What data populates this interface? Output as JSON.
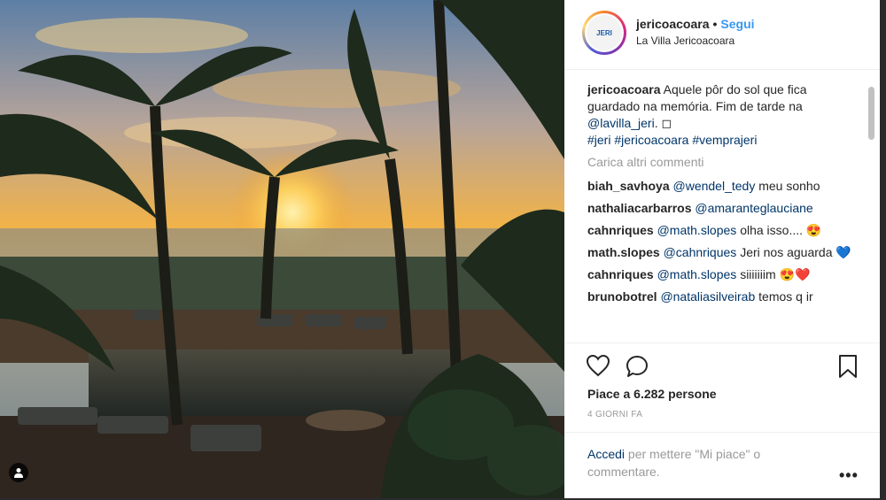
{
  "post": {
    "username": "jericoacoara",
    "follow_label": "Segui",
    "separator": "•",
    "location": "La Villa Jericoacoara",
    "avatar_text": "JERI"
  },
  "caption": {
    "user": "jericoacoara",
    "text_1": "Aquele pôr do sol que fica guardado na memória. Fim de tarde na",
    "mention": "@lavilla_jeri",
    "text_2": ". ◻",
    "hashtags": [
      "#jeri",
      "#jericoacoara",
      "#vemprajeri"
    ]
  },
  "load_more_label": "Carica altri commenti",
  "comments": [
    {
      "user": "biah_savhoya",
      "mention": "@wendel_tedy",
      "text": "meu sonho"
    },
    {
      "user": "nathaliacarbarros",
      "mention": "@amaranteglauciane",
      "text": ""
    },
    {
      "user": "cahnriques",
      "mention": "@math.slopes",
      "text": "olha isso.... 😍"
    },
    {
      "user": "math.slopes",
      "mention": "@cahnriques",
      "text": "Jeri nos aguarda 💙"
    },
    {
      "user": "cahnriques",
      "mention": "@math.slopes",
      "text": "siiiiiiim 😍❤️"
    },
    {
      "user": "brunobotrel",
      "mention": "@nataliasilveirab",
      "text": "temos q ir"
    }
  ],
  "likes_label": "Piace a 6.282 persone",
  "time_label": "4 GIORNI FA",
  "login": {
    "link": "Accedi",
    "text": "per mettere \"Mi piace\" o commentare."
  },
  "more_label": "•••",
  "colors": {
    "link": "#003569",
    "follow": "#3897f0",
    "muted": "#999999"
  },
  "icons": [
    "heart-icon",
    "comment-icon",
    "bookmark-icon",
    "user-tag-icon",
    "more-options-icon"
  ]
}
